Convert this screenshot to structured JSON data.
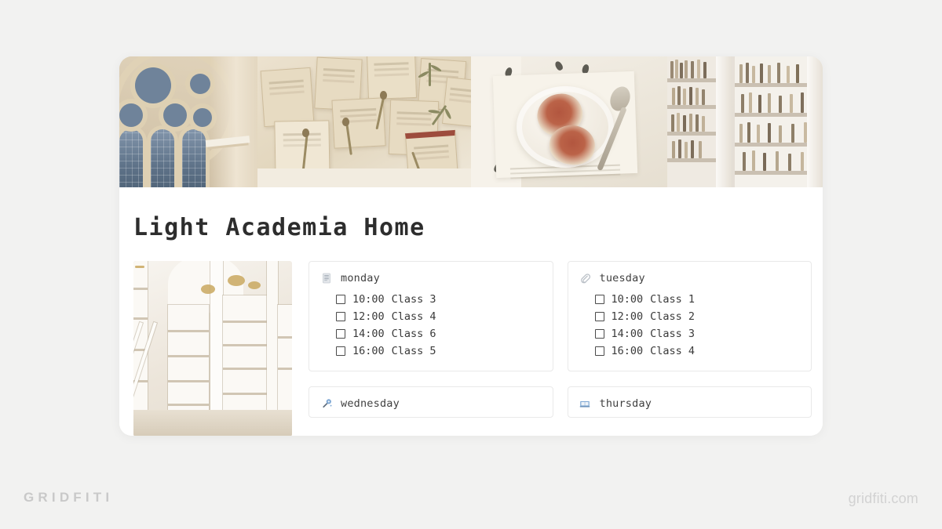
{
  "colors": {
    "page_background": "#f2f2f1",
    "window_background": "#ffffff",
    "card_border": "#e9e9e9",
    "title_text": "#2d2d2d",
    "body_text": "#3a3a3a",
    "brand_grey": "#c9c9c9",
    "icon_blue": "#7fa8d4"
  },
  "header": {
    "cover_images": [
      {
        "name": "gothic-cathedral-window",
        "alt": "Gothic cathedral stone tracery window with blue stained glass"
      },
      {
        "name": "vintage-books-flowers",
        "alt": "Flat lay of vintage cream books with pressed dried flowers"
      },
      {
        "name": "figs-on-plate",
        "alt": "Halved figs on a ceramic plate with a silver spoon on lace linen"
      },
      {
        "name": "white-library-shelves",
        "alt": "Tall white library bookshelves"
      }
    ]
  },
  "page": {
    "title": "Light Academia Home",
    "side_photo": {
      "name": "baroque-library-hall",
      "alt": "White and gold baroque library hall with ladder"
    }
  },
  "schedule": [
    {
      "day": "monday",
      "icon": "document-icon",
      "tasks": [
        {
          "time": "10:00",
          "label": "Class 3",
          "checked": false
        },
        {
          "time": "12:00",
          "label": "Class 4",
          "checked": false
        },
        {
          "time": "14:00",
          "label": "Class 6",
          "checked": false
        },
        {
          "time": "16:00",
          "label": "Class 5",
          "checked": false
        }
      ]
    },
    {
      "day": "tuesday",
      "icon": "paperclip-icon",
      "tasks": [
        {
          "time": "10:00",
          "label": "Class 1",
          "checked": false
        },
        {
          "time": "12:00",
          "label": "Class 2",
          "checked": false
        },
        {
          "time": "14:00",
          "label": "Class 3",
          "checked": false
        },
        {
          "time": "16:00",
          "label": "Class 4",
          "checked": false
        }
      ]
    },
    {
      "day": "wednesday",
      "icon": "magic-wand-icon",
      "tasks": []
    },
    {
      "day": "thursday",
      "icon": "open-book-icon",
      "tasks": []
    }
  ],
  "footer": {
    "brand_wordmark": "GRIDFITI",
    "brand_url": "gridfiti.com"
  }
}
